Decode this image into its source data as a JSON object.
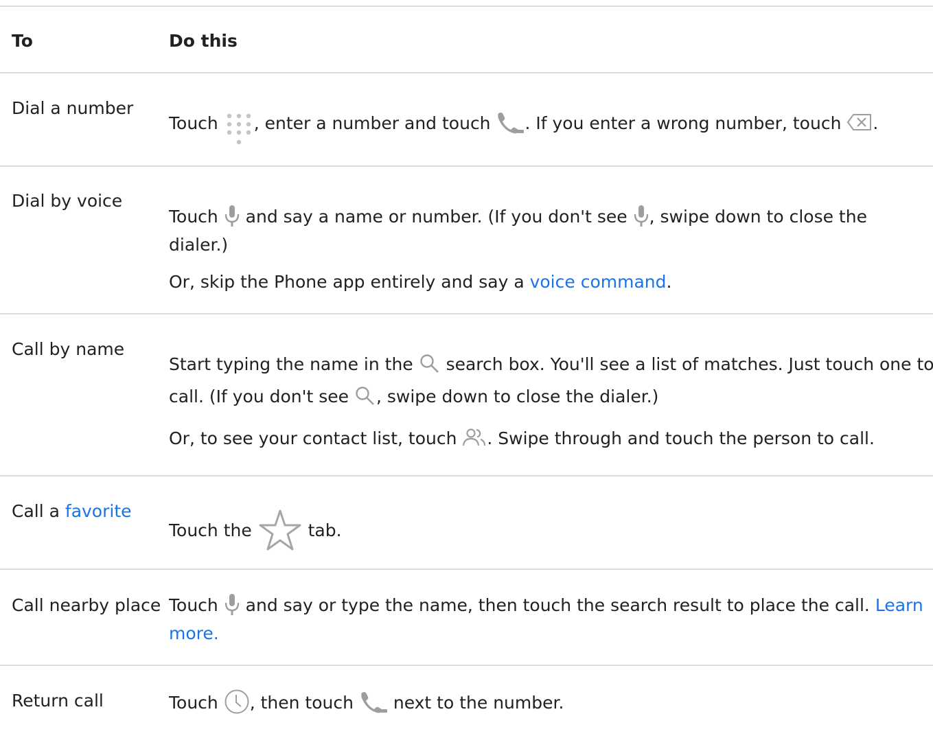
{
  "header": {
    "col_to": "To",
    "col_do": "Do this"
  },
  "rows": [
    {
      "to": "Dial a number",
      "l1a": "Touch ",
      "l1b": ", enter a number and touch ",
      "l1c": ". If you enter a wrong number, touch ",
      "l1d": "."
    },
    {
      "to": "Dial by voice",
      "l1a": "Touch ",
      "l1b": " and say a name or number. (If you don't see ",
      "l1c": ", swipe down to close the",
      "l2": "dialer.)",
      "p2a": "Or, skip the Phone app entirely and say a ",
      "p2link": "voice command",
      "p2b": "."
    },
    {
      "to": "Call by name",
      "l1a": "Start typing the name in the ",
      "l1b": " search box. You'll see a list of matches. Just touch one to",
      "l2a": "call. (If you don't see ",
      "l2b": ", swipe down to close the dialer.)",
      "p2a": "Or, to see your contact list, touch ",
      "p2b": ". Swipe through and touch the person to call."
    },
    {
      "to_a": "Call a ",
      "to_link": "favorite",
      "l1a": "Touch the ",
      "l1b": " tab."
    },
    {
      "to": "Call nearby place",
      "l1a": "Touch ",
      "l1b": " and say or type the name, then touch the search result to place the call. ",
      "l1link": "Learn",
      "l2link": "more."
    },
    {
      "to": "Return call",
      "l1a": "Touch ",
      "l1b": ", then touch ",
      "l1c": " next to the number."
    }
  ],
  "icons": {
    "dialpad": "dialpad-icon",
    "phone": "phone-icon",
    "backspace": "backspace-icon",
    "mic": "microphone-icon",
    "search": "search-icon",
    "contacts": "contacts-icon",
    "star": "star-icon",
    "clock": "clock-icon"
  },
  "colors": {
    "link": "#1a73e8",
    "icon": "#9e9e9e",
    "divider": "#dadce0",
    "text": "#202124"
  }
}
